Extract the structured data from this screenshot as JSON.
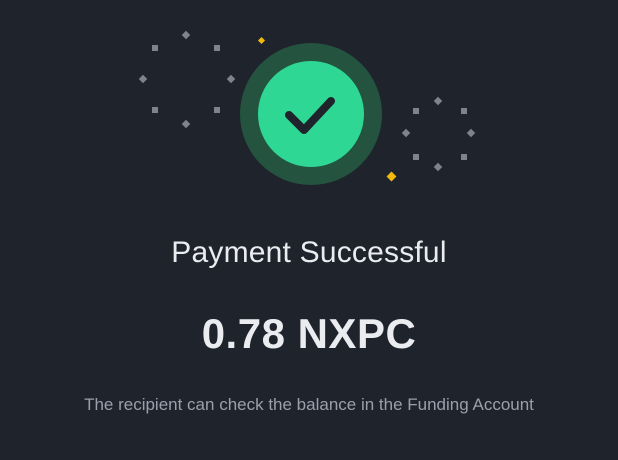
{
  "dialog": {
    "icon": "check-circle-icon",
    "title": "Payment Successful",
    "amount": "0.78 NXPC",
    "note": "The recipient can check the balance in the Funding Account"
  },
  "colors": {
    "background": "#1f232c",
    "success_green": "#2ed894",
    "success_ring": "#24533f",
    "checkmark": "#1f232c",
    "confetti_gray": "#7e838d",
    "confetti_gold": "#f0b90b",
    "text_primary": "#eaecef",
    "text_secondary": "#9aa0ab"
  }
}
